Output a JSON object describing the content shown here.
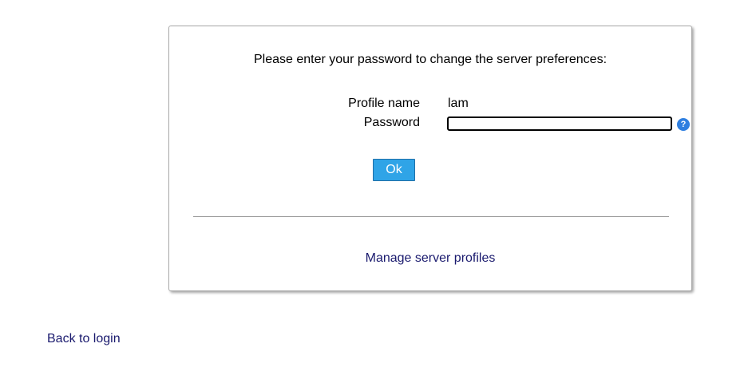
{
  "dialog": {
    "prompt": "Please enter your password to change the server preferences:",
    "profile_label": "Profile name",
    "profile_value": "lam",
    "password_label": "Password",
    "password_value": "",
    "help_icon": "help-icon",
    "help_glyph": "?",
    "ok_label": "Ok",
    "manage_link": "Manage server profiles"
  },
  "footer": {
    "back_link": "Back to login"
  },
  "colors": {
    "accent_button": "#2fa4e7",
    "help_icon": "#2f7fe0",
    "link": "#1a1a6e"
  }
}
